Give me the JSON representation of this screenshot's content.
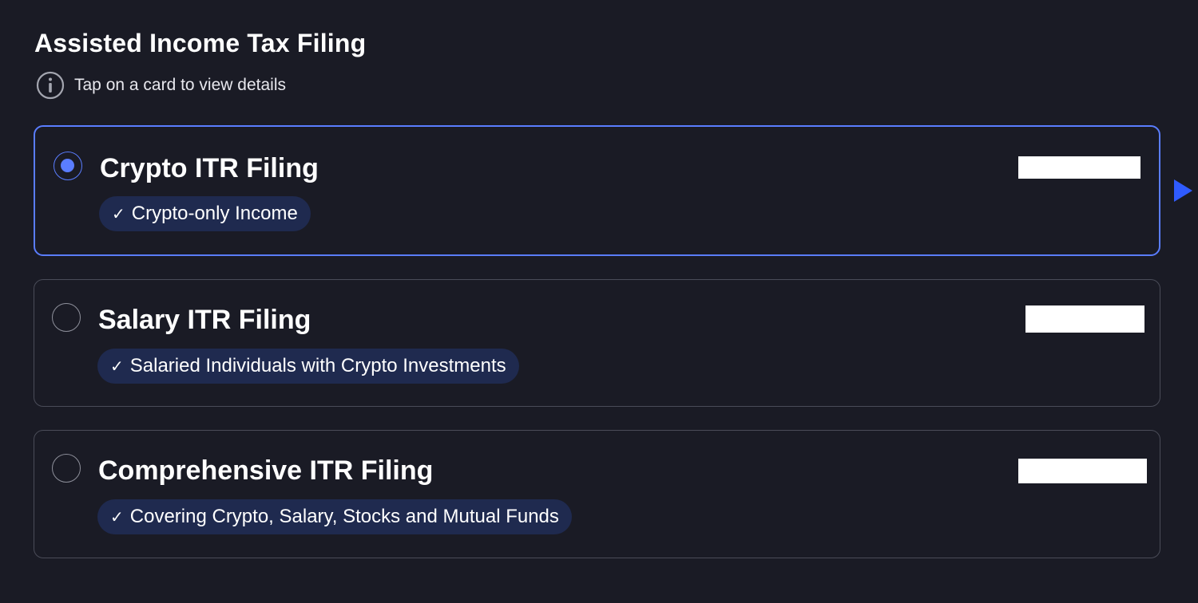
{
  "header": {
    "title": "Assisted Income Tax Filing",
    "hint_icon": "info-icon",
    "hint_text": "Tap on a card to view details"
  },
  "cards": [
    {
      "title": "Crypto ITR Filing",
      "tag_icon": "checkmark-icon",
      "tag_text": "Crypto-only Income",
      "selected": true
    },
    {
      "title": "Salary ITR Filing",
      "tag_icon": "checkmark-icon",
      "tag_text": "Salaried Individuals with Crypto Investments",
      "selected": false
    },
    {
      "title": "Comprehensive ITR Filing",
      "tag_icon": "checkmark-icon",
      "tag_text": "Covering Crypto, Salary, Stocks and Mutual Funds",
      "selected": false
    }
  ],
  "colors": {
    "background": "#1a1b25",
    "accent": "#5a7dff",
    "tag_background": "#1f2a4f",
    "card_border": "#4a4c58",
    "pointer_arrow": "#2f5bff"
  }
}
